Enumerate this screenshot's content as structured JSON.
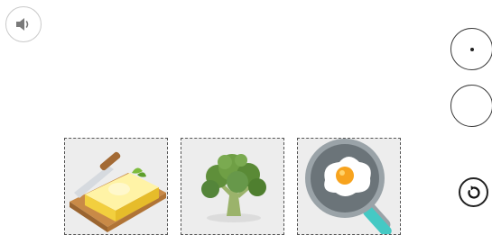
{
  "controls": {
    "audio_icon": "speaker-icon",
    "reset_icon": "reset-arrow-icon"
  },
  "answer_slots": [
    {
      "state": "cursor"
    },
    {
      "state": "empty"
    }
  ],
  "choices": [
    {
      "id": "butter",
      "icon": "butter-icon"
    },
    {
      "id": "broccoli",
      "icon": "broccoli-icon"
    },
    {
      "id": "fried-egg",
      "icon": "fried-egg-pan-icon"
    }
  ]
}
